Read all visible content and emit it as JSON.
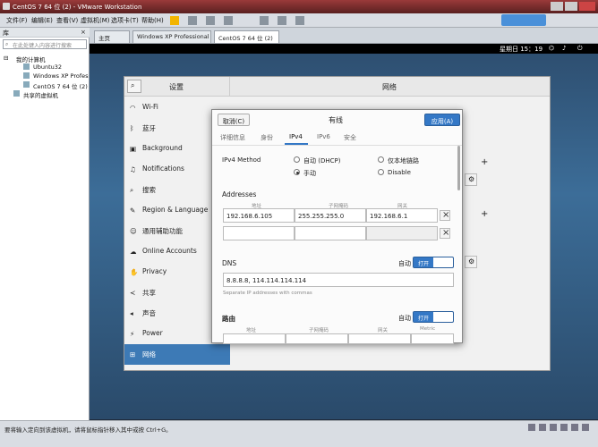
{
  "window": {
    "title": "CentOS 7 64 位 (2) - VMware Workstation"
  },
  "menu": {
    "file": "文件(F)",
    "edit": "编辑(E)",
    "view": "查看(V)",
    "vm": "虚拟机(M)",
    "tabs": "选项卡(T)",
    "help": "帮助(H)"
  },
  "library": {
    "header": "库",
    "search_placeholder": "在此处键入内容进行搜索",
    "root": "我的计算机",
    "vms": [
      "Ubuntu32",
      "Windows XP Professional",
      "CentOS 7 64 位 (2)"
    ],
    "shared": "共享的虚拟机"
  },
  "vm_tabs": [
    {
      "label": "主页"
    },
    {
      "label": "Windows XP Professional"
    },
    {
      "label": "CentOS 7 64 位 (2)"
    }
  ],
  "guest": {
    "clock": "星期日 15：19"
  },
  "settings": {
    "title": "设置",
    "panel_title": "网络",
    "categories": [
      "Wi-Fi",
      "蓝牙",
      "Background",
      "Notifications",
      "搜索",
      "Region & Language",
      "通用辅助功能",
      "Online Accounts",
      "Privacy",
      "共享",
      "声音",
      "Power",
      "网络"
    ]
  },
  "dialog": {
    "title": "有线",
    "cancel": "取消(C)",
    "apply": "应用(A)",
    "tabs": [
      "详细信息",
      "身份",
      "IPv4",
      "IPv6",
      "安全"
    ],
    "method_label": "IPv4 Method",
    "methods": {
      "auto_dhcp": "自动 (DHCP)",
      "link_local": "仅本地链路",
      "manual": "手动",
      "disable": "Disable"
    },
    "addresses_label": "Addresses",
    "col_address": "地址",
    "col_netmask": "子网掩码",
    "col_gateway": "网关",
    "address": "192.168.6.105",
    "netmask": "255.255.255.0",
    "gateway": "192.168.6.1",
    "dns_label": "DNS",
    "auto_label": "自动",
    "toggle_on": "打开",
    "dns_value": "8.8.8.8, 114.114.114.114",
    "dns_hint": "Separate IP addresses with commas",
    "routes_label": "路由",
    "col_metric": "Metric"
  },
  "statusbar": {
    "text": "要将输入定向到该虚拟机，请将鼠标指针移入其中或按 Ctrl+G。"
  },
  "colors": {
    "accent": "#3478c6",
    "titlebar": "#7a2a2a"
  },
  "icons": [
    "wifi-icon",
    "bluetooth-icon",
    "background-icon",
    "notifications-icon",
    "search-icon",
    "region-icon",
    "accessibility-icon",
    "online-accounts-icon",
    "privacy-icon",
    "share-icon",
    "sound-icon",
    "power-icon",
    "network-icon"
  ]
}
